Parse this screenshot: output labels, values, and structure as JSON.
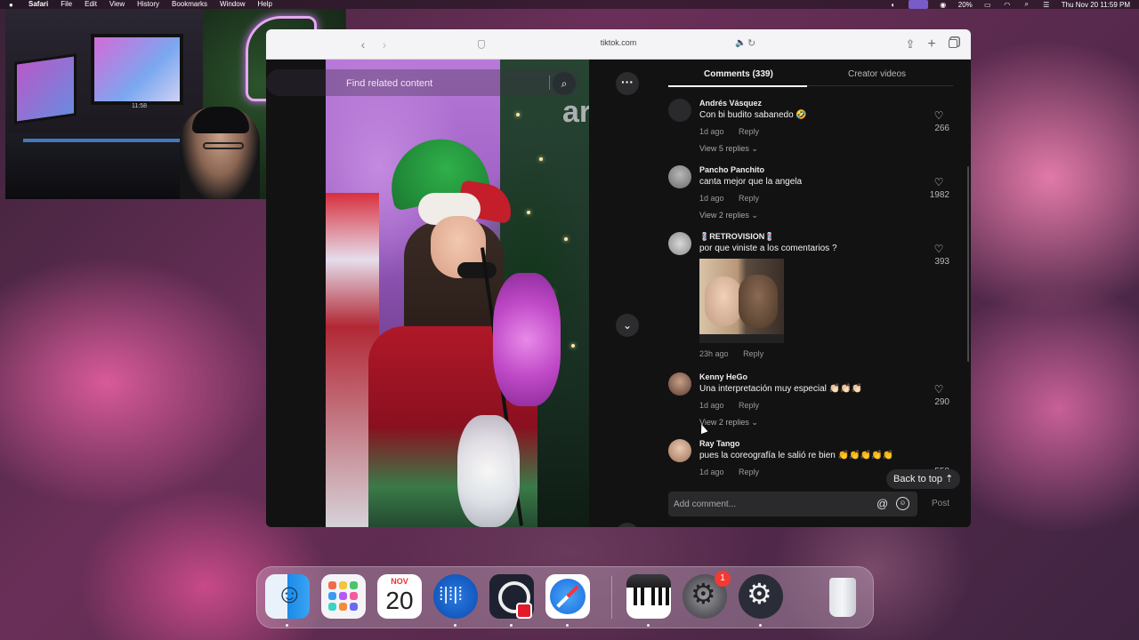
{
  "menubar": {
    "apple": "",
    "app_name": "Safari",
    "menus": [
      "File",
      "Edit",
      "View",
      "History",
      "Bookmarks",
      "Window",
      "Help"
    ],
    "battery": "20%",
    "datetime": "Thu Nov 20  11:59 PM"
  },
  "webcam": {
    "clock_label": "11:58"
  },
  "browser": {
    "url": "tiktok.com",
    "icons": {
      "back": "chevron-left-icon",
      "forward": "chevron-right-icon",
      "share": "share-icon",
      "new_tab": "plus-icon",
      "tabs": "tabs-overview-icon"
    }
  },
  "video": {
    "search_placeholder": "Find related content",
    "sign_text": "ar"
  },
  "panel": {
    "tabs": [
      {
        "label": "Comments (339)",
        "active": true
      },
      {
        "label": "Creator videos",
        "active": false
      }
    ],
    "comments": [
      {
        "name": "Andrés Vásquez",
        "text": "Con bi budito sabanedo 🤣",
        "time": "1d ago",
        "reply": "Reply",
        "likes": "266",
        "view_replies": "View 5 replies"
      },
      {
        "name": "Pancho Panchito",
        "text": "canta mejor que la angela",
        "time": "1d ago",
        "reply": "Reply",
        "likes": "1982",
        "view_replies": "View 2 replies"
      },
      {
        "name": "💈RETROVISION💈",
        "text": "por que viniste a los comentarios ?",
        "time": "23h ago",
        "reply": "Reply",
        "likes": "393",
        "view_replies": ""
      },
      {
        "name": "Kenny HeGo",
        "text": "Una interpretación muy especial 👏🏻👏🏻👏🏻",
        "time": "1d ago",
        "reply": "Reply",
        "likes": "290",
        "view_replies": "View 2 replies"
      },
      {
        "name": "Ray Tango",
        "text": "pues la coreografía le salió re bien 👏👏👏👏👏",
        "time": "1d ago",
        "reply": "Reply",
        "likes": "558",
        "view_replies": ""
      }
    ],
    "back_to_top": "Back to top",
    "input_placeholder": "Add comment...",
    "post_label": "Post"
  },
  "dock": {
    "calendar_month": "NOV",
    "calendar_day": "20",
    "settings_badge": "1",
    "apps": [
      "finder-icon",
      "launchpad-icon",
      "calendar-icon",
      "audio-app-icon",
      "obs-icon",
      "safari-icon",
      "piano-app-icon",
      "system-settings-icon",
      "chatgpt-icon",
      "trash-icon"
    ]
  }
}
